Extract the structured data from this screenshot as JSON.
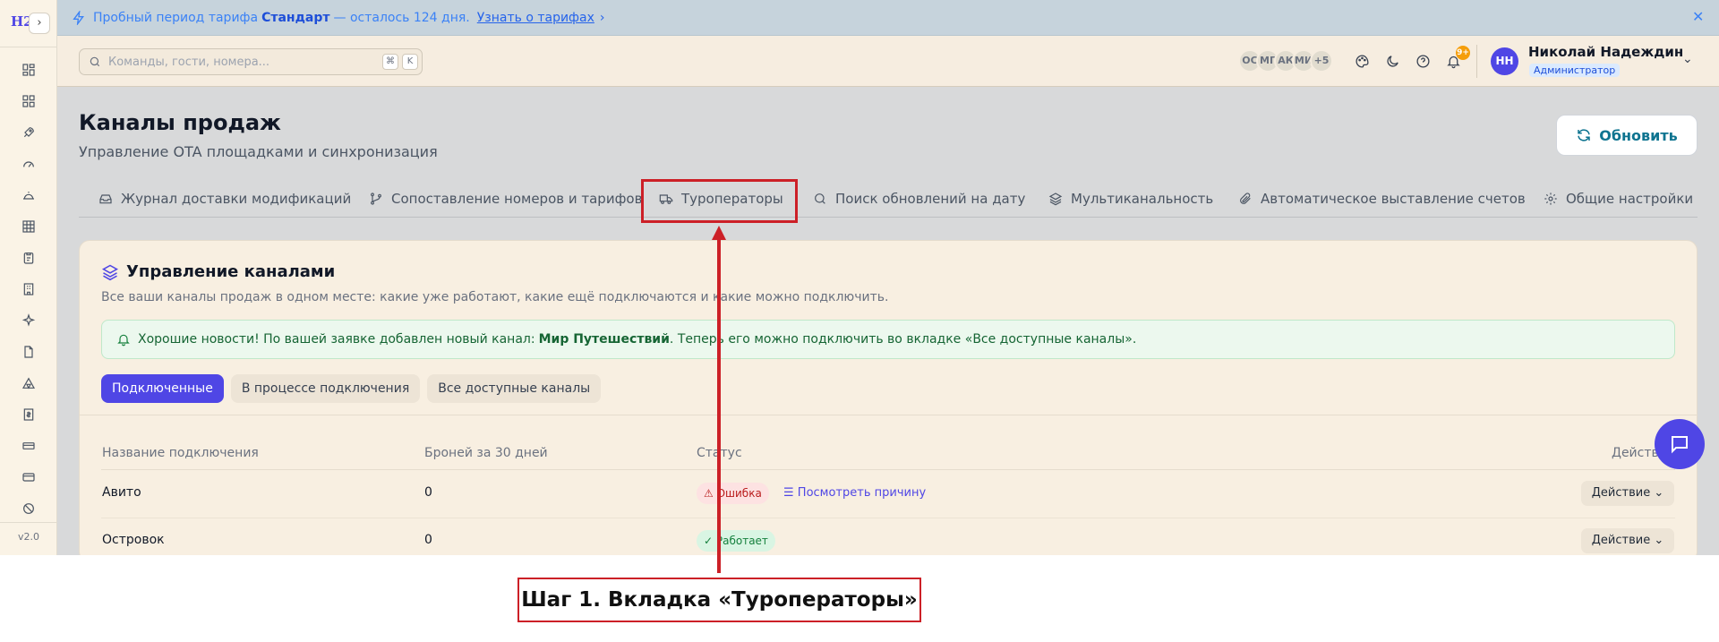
{
  "app": {
    "logo": "H2",
    "version": "v2.0"
  },
  "banner": {
    "prefix": "Пробный период тарифа",
    "plan": "Стандарт",
    "suffix": "— осталось 124 дня.",
    "link": "Узнать о тарифах"
  },
  "search": {
    "placeholder": "Команды, гости, номера...",
    "key1": "⌘",
    "key2": "K"
  },
  "header": {
    "avatars": [
      "ОС",
      "МГ",
      "АК",
      "МИ",
      "+5"
    ],
    "notif_count": "9+",
    "user_initials": "НН",
    "user_name": "Николай Надеждин",
    "user_role": "Администратор"
  },
  "page": {
    "title": "Каналы продаж",
    "subtitle": "Управление OTA площадками и синхронизация",
    "refresh": "Обновить"
  },
  "tabs": [
    {
      "label": "Журнал доставки модификаций",
      "icon": "inbox-icon"
    },
    {
      "label": "Сопоставление номеров и тарифов",
      "icon": "git-branch-icon"
    },
    {
      "label": "Туроператоры",
      "icon": "truck-icon"
    },
    {
      "label": "Поиск обновлений на дату",
      "icon": "search-icon"
    },
    {
      "label": "Мультиканальность",
      "icon": "layers-icon"
    },
    {
      "label": "Автоматическое выставление счетов",
      "icon": "paperclip-icon"
    },
    {
      "label": "Общие настройки",
      "icon": "gear-icon"
    }
  ],
  "card": {
    "title": "Управление каналами",
    "description": "Все ваши каналы продаж в одном месте: какие уже работают, какие ещё подключаются и какие можно подключить.",
    "notice_prefix": "Хорошие новости! По вашей заявке добавлен новый канал:",
    "notice_channel": "Мир Путешествий",
    "notice_suffix": ". Теперь его можно подключить во вкладке «Все доступные каналы».",
    "filters": [
      "Подключенные",
      "В процессе подключения",
      "Все доступные каналы"
    ]
  },
  "table": {
    "headers": [
      "Название подключения",
      "Броней за 30 дней",
      "Статус",
      "Действия"
    ],
    "rows": [
      {
        "name": "Авито",
        "bookings": "0",
        "status": "Ошибка",
        "status_type": "error",
        "reason": "Посмотреть причину",
        "action": "Действие"
      },
      {
        "name": "Островок",
        "bookings": "0",
        "status": "Работает",
        "status_type": "ok",
        "reason": "",
        "action": "Действие"
      }
    ]
  },
  "annotation": {
    "step": "Шаг 1. Вкладка «Туроператоры»"
  },
  "colors": {
    "accent": "#4f46e5",
    "annotation": "#cc2027",
    "banner_bg": "#c6d3dc"
  }
}
